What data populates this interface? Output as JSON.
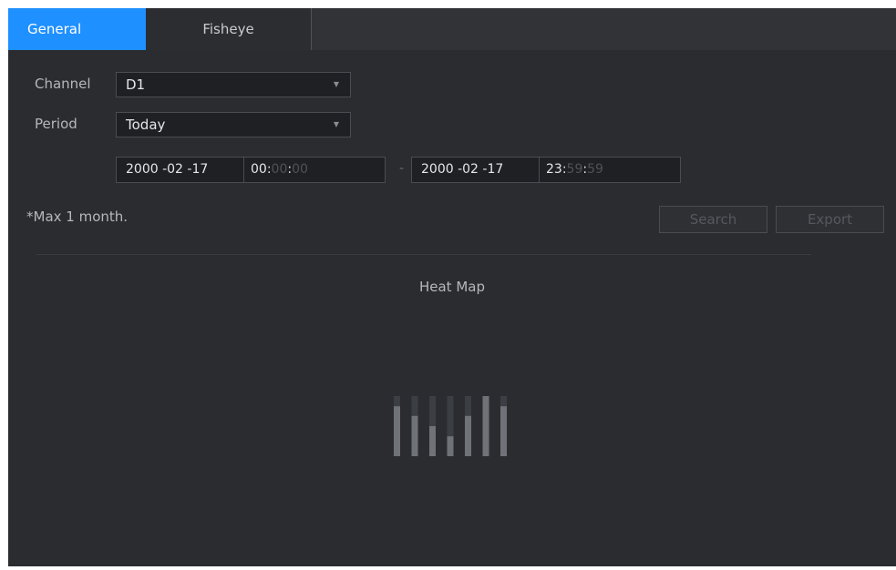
{
  "tabs": [
    {
      "label": "General",
      "active": true
    },
    {
      "label": "Fisheye",
      "active": false
    }
  ],
  "form": {
    "channel_label": "Channel",
    "channel_value": "D1",
    "period_label": "Period",
    "period_value": "Today",
    "start_date": "2000 -02 -17",
    "start_hh": "00",
    "start_mm": "00",
    "start_ss": "00",
    "end_date": "2000 -02 -17",
    "end_hh": "23",
    "end_mm": "59",
    "end_ss": "59",
    "range_separator": "-",
    "time_colon": ":",
    "note": "*Max 1 month."
  },
  "buttons": {
    "search": "Search",
    "export": "Export"
  },
  "heatmap": {
    "title": "Heat Map",
    "loading_bar_levels": [
      0.83,
      0.67,
      0.5,
      0.33,
      0.67,
      1.0,
      0.83
    ]
  },
  "colors": {
    "accent": "#1e90ff",
    "background": "#2a2c30"
  }
}
